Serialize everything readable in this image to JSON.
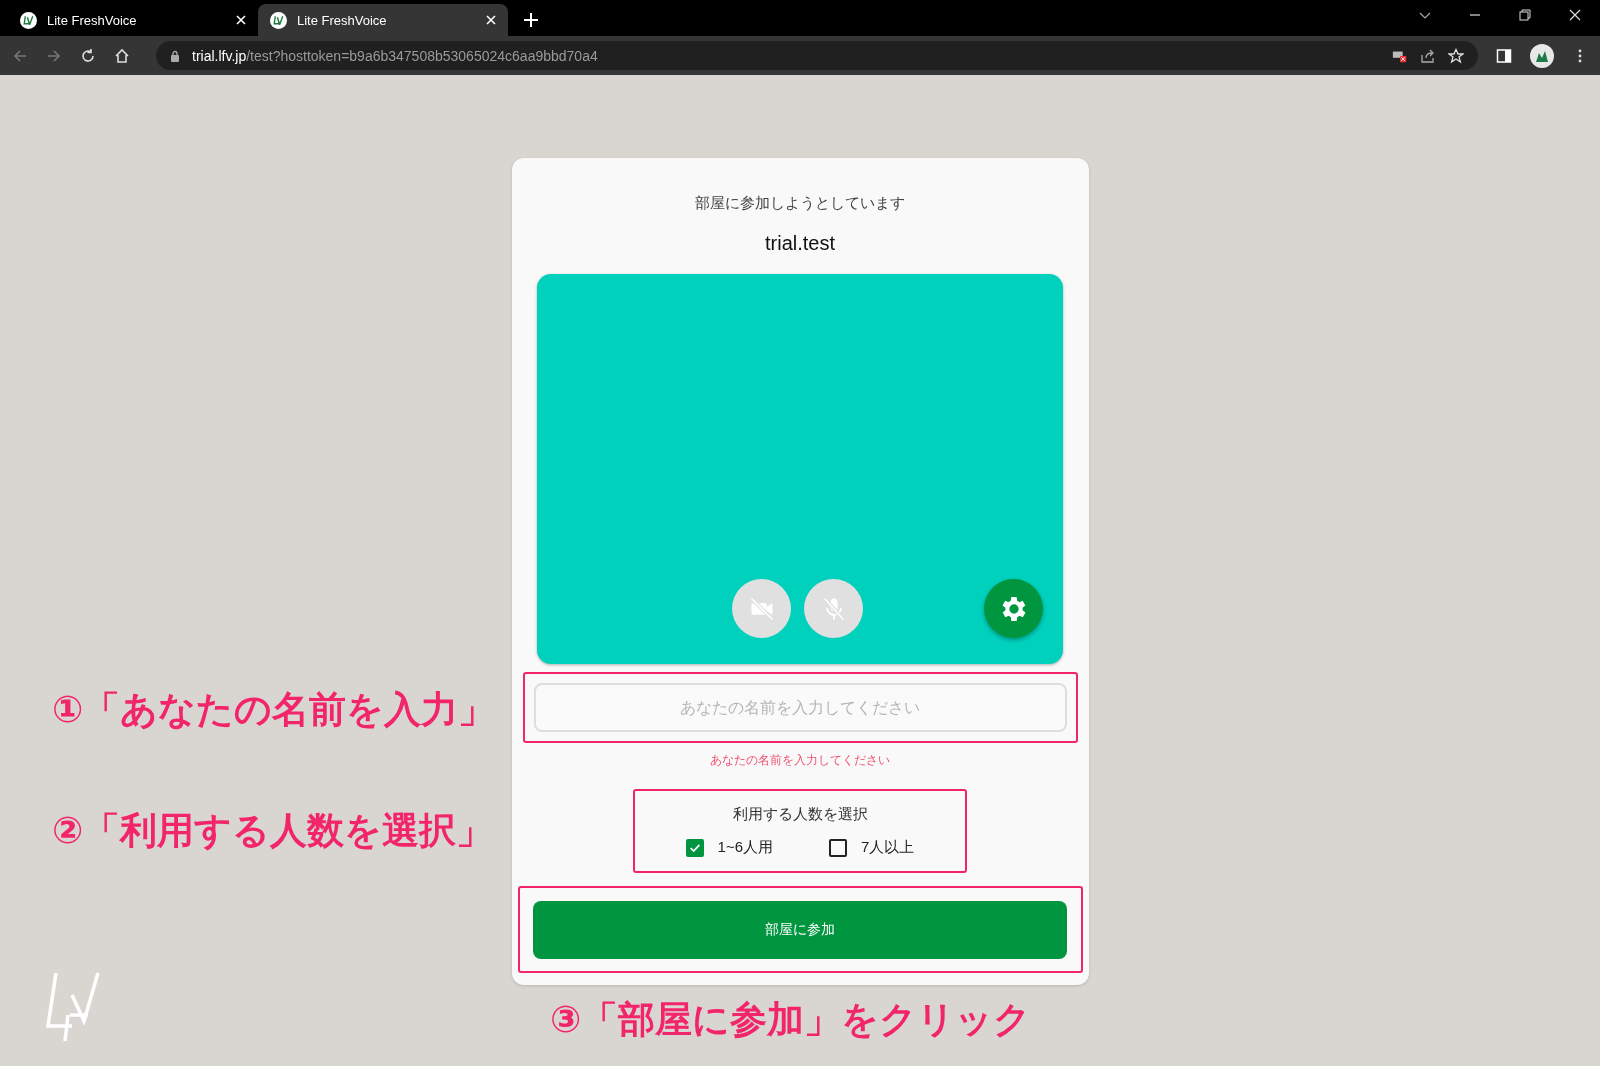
{
  "browser": {
    "tabs": [
      {
        "title": "Lite FreshVoice",
        "selected": false
      },
      {
        "title": "Lite FreshVoice",
        "selected": true
      }
    ],
    "address": {
      "host": "trial.lfv.jp",
      "path": "/test?hosttoken=b9a6b347508b53065024c6aa9bbd70a4"
    }
  },
  "card": {
    "subtitle": "部屋に参加しようとしています",
    "room": "trial.test",
    "camera_on": false,
    "mic_on": false,
    "name_field": {
      "placeholder": "あなたの名前を入力してください",
      "error": "あなたの名前を入力してください"
    },
    "people": {
      "title": "利用する人数を選択",
      "options": [
        {
          "label": "1~6人用",
          "checked": true
        },
        {
          "label": "7人以上",
          "checked": false
        }
      ]
    },
    "join_button": "部屋に参加"
  },
  "annotations": [
    {
      "text": "①「あなたの名前を入力」"
    },
    {
      "text": "②「利用する人数を選択」"
    },
    {
      "text": "③「部屋に参加」をクリック"
    }
  ]
}
